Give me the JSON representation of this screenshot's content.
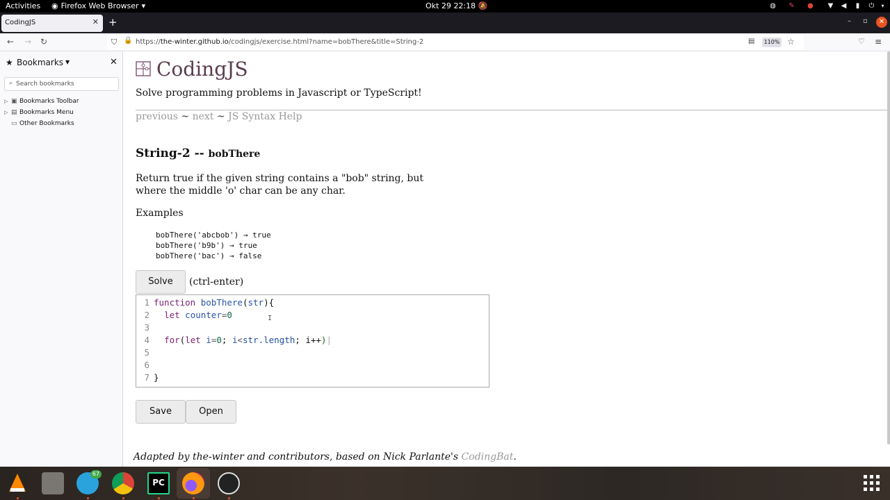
{
  "system_bar": {
    "activities": "Activities",
    "app_menu": "Firefox Web Browser",
    "clock": "Okt 29  22:18"
  },
  "browser": {
    "tab_title": "CodingJS",
    "url_prefix": "https://",
    "url_host": "the-winter.github.io",
    "url_path": "/codingjs/exercise.html?name=bobThere&title=String-2",
    "zoom": "110%"
  },
  "sidebar": {
    "title": "Bookmarks",
    "search_placeholder": "Search bookmarks",
    "items": [
      {
        "label": "Bookmarks Toolbar",
        "expandable": true
      },
      {
        "label": "Bookmarks Menu",
        "expandable": true
      },
      {
        "label": "Other Bookmarks",
        "expandable": false
      }
    ]
  },
  "page": {
    "site_title": "CodingJS",
    "description": "Solve programming problems in Javascript or TypeScript!",
    "nav": {
      "previous": "previous",
      "next": "next",
      "help": "JS Syntax Help",
      "separator": "~"
    },
    "problem_category": "String-2 --",
    "problem_name": "bobThere",
    "problem_desc": "Return true if the given string contains a \"bob\" string, but where the middle 'o' char can be any char.",
    "examples_label": "Examples",
    "examples": [
      "bobThere('abcbob') → true",
      "bobThere('b9b') → true",
      "bobThere('bac') → false"
    ],
    "solve_label": "Solve",
    "solve_hint": "(ctrl-enter)",
    "save_label": "Save",
    "open_label": "Open",
    "footer_text": "Adapted by the-winter and contributors, based on Nick Parlante's ",
    "footer_link": "CodingBat",
    "footer_end": "."
  },
  "editor": {
    "line_numbers": [
      "1",
      "2",
      "3",
      "4",
      "5",
      "6",
      "7"
    ],
    "kw_function": "function",
    "fn_name": "bobThere",
    "param": "str",
    "kw_let": "let",
    "var_counter": "counter",
    "num_zero": "0",
    "kw_for": "for",
    "var_i": "i",
    "length_expr": "str.length",
    "incr": "i++",
    "close_brace": "}"
  },
  "dock": {
    "telegram_badge": "67",
    "pycharm_label": "PC"
  }
}
